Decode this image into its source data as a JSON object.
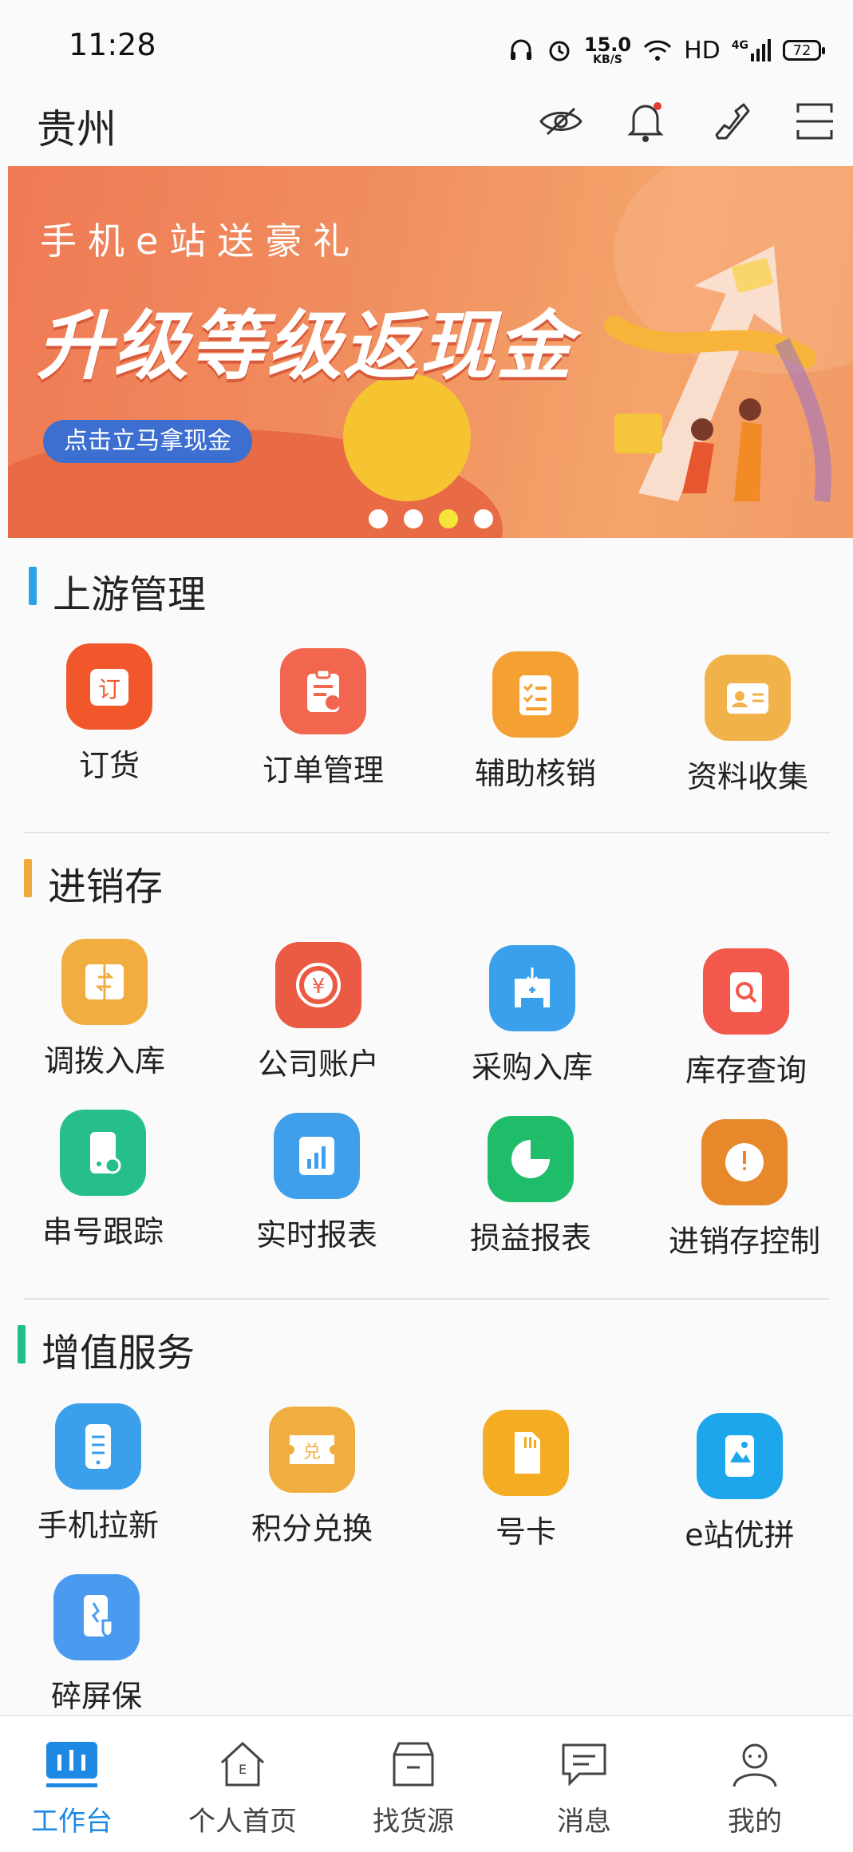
{
  "status_bar": {
    "time": "11:28",
    "net_speed_value": "15.0",
    "net_speed_unit": "KB/S",
    "network": "HD",
    "signal": "4G",
    "battery": "72"
  },
  "header": {
    "city": "贵州",
    "icons": [
      "eye-off-icon",
      "bell-icon",
      "phone-icon",
      "scan-icon"
    ]
  },
  "banner": {
    "subtitle": "手机e站送豪礼",
    "title": "升级等级返现金",
    "button": "点击立马拿现金",
    "slide_count": 4,
    "active_slide": 3
  },
  "sections": [
    {
      "title": "上游管理",
      "accent": "#2aa2e6",
      "items": [
        {
          "label": "订货",
          "icon": "order-icon",
          "color": "#f2572b"
        },
        {
          "label": "订单管理",
          "icon": "clipboard-icon",
          "color": "#f26650"
        },
        {
          "label": "辅助核销",
          "icon": "checklist-icon",
          "color": "#f5a032"
        },
        {
          "label": "资料收集",
          "icon": "id-card-icon",
          "color": "#f1b24a"
        }
      ]
    },
    {
      "title": "进销存",
      "accent": "#f0a93a",
      "items": [
        {
          "label": "调拨入库",
          "icon": "transfer-icon",
          "color": "#f1ad3f"
        },
        {
          "label": "公司账户",
          "icon": "yuan-icon",
          "color": "#eb5a42"
        },
        {
          "label": "采购入库",
          "icon": "purchase-icon",
          "color": "#3aa0ec"
        },
        {
          "label": "库存查询",
          "icon": "search-doc-icon",
          "color": "#f2584c"
        },
        {
          "label": "串号跟踪",
          "icon": "phone-track-icon",
          "color": "#26bf8c"
        },
        {
          "label": "实时报表",
          "icon": "bar-chart-icon",
          "color": "#3f9fea"
        },
        {
          "label": "损益报表",
          "icon": "pie-chart-icon",
          "color": "#1fbd6a"
        },
        {
          "label": "进销存控制",
          "icon": "power-icon",
          "color": "#e7882b"
        }
      ]
    },
    {
      "title": "增值服务",
      "accent": "#1fbf8a",
      "items": [
        {
          "label": "手机拉新",
          "icon": "mobile-icon",
          "color": "#3b9fec"
        },
        {
          "label": "积分兑换",
          "icon": "ticket-icon",
          "color": "#f1ae40"
        },
        {
          "label": "号卡",
          "icon": "sim-card-icon",
          "color": "#f4ad22"
        },
        {
          "label": "e站优拼",
          "icon": "photo-icon",
          "color": "#1ea6ec"
        },
        {
          "label": "碎屏保",
          "icon": "screen-guard-icon",
          "color": "#4a9af0"
        }
      ]
    }
  ],
  "tabbar": [
    {
      "label": "工作台",
      "icon": "workbench-icon",
      "active": true
    },
    {
      "label": "个人首页",
      "icon": "home-icon",
      "active": false
    },
    {
      "label": "找货源",
      "icon": "box-icon",
      "active": false
    },
    {
      "label": "消息",
      "icon": "message-icon",
      "active": false
    },
    {
      "label": "我的",
      "icon": "user-icon",
      "active": false
    }
  ]
}
